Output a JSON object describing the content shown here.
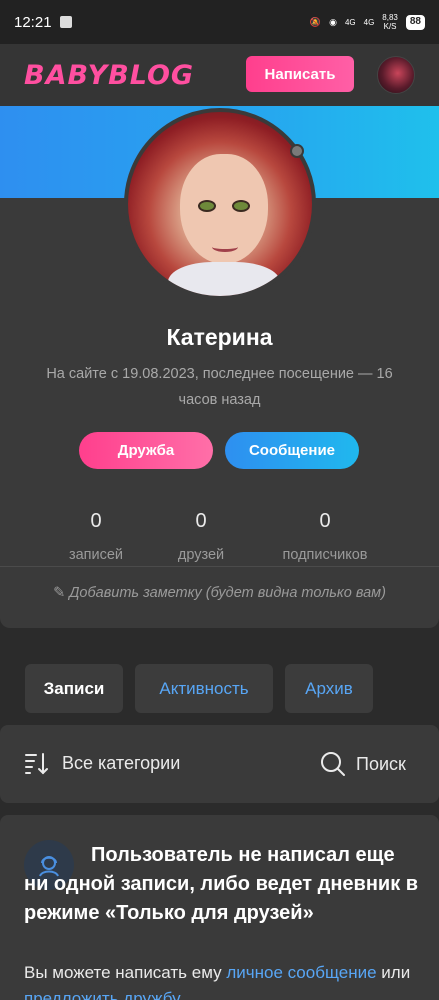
{
  "statusbar": {
    "time": "12:21",
    "net1": "4G",
    "net2": "4G",
    "speed": "8,83",
    "speed_unit": "K/S",
    "battery": "88"
  },
  "header": {
    "logo": "BABYBLOG",
    "write_label": "Написать"
  },
  "profile": {
    "name": "Катерина",
    "visit_info": "На сайте с 19.08.2023, последнее посещение — 16 часов назад",
    "friend_label": "Дружба",
    "message_label": "Сообщение",
    "stats": [
      {
        "value": "0",
        "label": "записей"
      },
      {
        "value": "0",
        "label": "друзей"
      },
      {
        "value": "0",
        "label": "подписчиков"
      }
    ],
    "note_label": "Добавить заметку (будет видна только вам)"
  },
  "tabs": [
    {
      "label": "Записи"
    },
    {
      "label": "Активность"
    },
    {
      "label": "Архив"
    }
  ],
  "filter": {
    "categories_label": "Все категории",
    "search_label": "Поиск"
  },
  "empty": {
    "title": "Пользователь не написал еще ни одной записи, либо ведет дневник в режиме «Только для друзей»",
    "text_start": "Вы можете написать ему ",
    "link1": "личное сообщение",
    "text_mid": " или ",
    "link2": "предложить дружбу"
  },
  "colors": {
    "accent_pink": "#ff3f8d",
    "accent_blue": "#2e8ff0",
    "link_blue": "#58a6f5",
    "background": "#2b2b2b"
  }
}
